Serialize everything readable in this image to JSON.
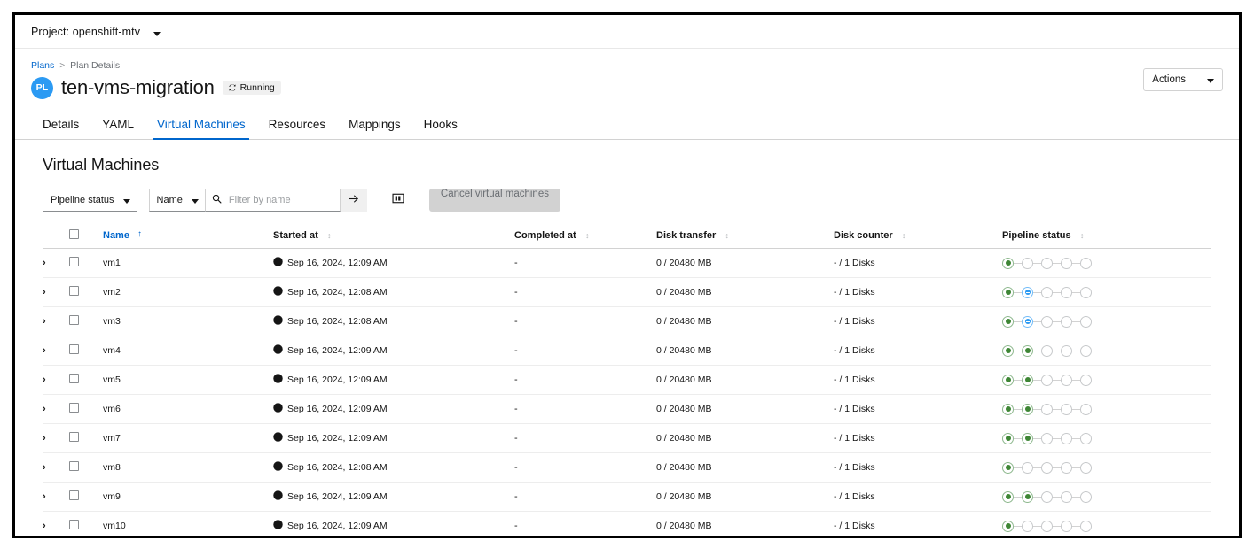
{
  "project_bar": {
    "label": "Project: openshift-mtv",
    "caret_icon": "chevron-down-icon"
  },
  "breadcrumb": {
    "root": "Plans",
    "separator": ">",
    "current": "Plan Details"
  },
  "header": {
    "badge": "PL",
    "title": "ten-vms-migration",
    "status": "Running",
    "status_icon": "sync-icon",
    "actions_label": "Actions",
    "actions_caret_icon": "chevron-down-icon"
  },
  "tabs": [
    {
      "label": "Details",
      "active": false
    },
    {
      "label": "YAML",
      "active": false
    },
    {
      "label": "Virtual Machines",
      "active": true
    },
    {
      "label": "Resources",
      "active": false
    },
    {
      "label": "Mappings",
      "active": false
    },
    {
      "label": "Hooks",
      "active": false
    }
  ],
  "section": {
    "title": "Virtual Machines"
  },
  "toolbar": {
    "pipeline_status_filter": "Pipeline status",
    "attribute_filter": "Name",
    "search_placeholder": "Filter by name",
    "search_value": "",
    "search_icon": "search-icon",
    "submit_icon": "arrow-right-icon",
    "columns_icon": "columns-management-icon",
    "cancel_label": "Cancel virtual machines"
  },
  "table": {
    "columns": [
      {
        "label": "",
        "sort": "none",
        "key": "toggle"
      },
      {
        "label": "",
        "sort": "none",
        "key": "checkbox"
      },
      {
        "label": "Name",
        "sort": "asc",
        "key": "name"
      },
      {
        "label": "Started at",
        "sort": "idle",
        "key": "started_at"
      },
      {
        "label": "Completed at",
        "sort": "idle",
        "key": "completed_at"
      },
      {
        "label": "Disk transfer",
        "sort": "idle",
        "key": "disk_transfer"
      },
      {
        "label": "Disk counter",
        "sort": "idle",
        "key": "disk_counter"
      },
      {
        "label": "Pipeline status",
        "sort": "idle",
        "key": "pipeline_status"
      }
    ],
    "sort_asc_glyph": "↑",
    "sort_idle_glyph": "↕",
    "expand_glyph": "›",
    "clock_icon": "globe-clock-icon",
    "rows": [
      {
        "name": "vm1",
        "started_at": "Sep 16, 2024, 12:09 AM",
        "completed_at": "-",
        "disk_transfer": "0 / 20480 MB",
        "disk_counter": "- / 1 Disks",
        "pipeline": [
          "green",
          "empty",
          "empty",
          "empty",
          "empty"
        ]
      },
      {
        "name": "vm2",
        "started_at": "Sep 16, 2024, 12:08 AM",
        "completed_at": "-",
        "disk_transfer": "0 / 20480 MB",
        "disk_counter": "- / 1 Disks",
        "pipeline": [
          "green",
          "blue",
          "empty",
          "empty",
          "empty"
        ]
      },
      {
        "name": "vm3",
        "started_at": "Sep 16, 2024, 12:08 AM",
        "completed_at": "-",
        "disk_transfer": "0 / 20480 MB",
        "disk_counter": "- / 1 Disks",
        "pipeline": [
          "green",
          "blue",
          "empty",
          "empty",
          "empty"
        ]
      },
      {
        "name": "vm4",
        "started_at": "Sep 16, 2024, 12:09 AM",
        "completed_at": "-",
        "disk_transfer": "0 / 20480 MB",
        "disk_counter": "- / 1 Disks",
        "pipeline": [
          "green",
          "green",
          "empty",
          "empty",
          "empty"
        ]
      },
      {
        "name": "vm5",
        "started_at": "Sep 16, 2024, 12:09 AM",
        "completed_at": "-",
        "disk_transfer": "0 / 20480 MB",
        "disk_counter": "- / 1 Disks",
        "pipeline": [
          "green",
          "green",
          "empty",
          "empty",
          "empty"
        ]
      },
      {
        "name": "vm6",
        "started_at": "Sep 16, 2024, 12:09 AM",
        "completed_at": "-",
        "disk_transfer": "0 / 20480 MB",
        "disk_counter": "- / 1 Disks",
        "pipeline": [
          "green",
          "green",
          "empty",
          "empty",
          "empty"
        ]
      },
      {
        "name": "vm7",
        "started_at": "Sep 16, 2024, 12:09 AM",
        "completed_at": "-",
        "disk_transfer": "0 / 20480 MB",
        "disk_counter": "- / 1 Disks",
        "pipeline": [
          "green",
          "green",
          "empty",
          "empty",
          "empty"
        ]
      },
      {
        "name": "vm8",
        "started_at": "Sep 16, 2024, 12:08 AM",
        "completed_at": "-",
        "disk_transfer": "0 / 20480 MB",
        "disk_counter": "- / 1 Disks",
        "pipeline": [
          "green",
          "empty",
          "empty",
          "empty",
          "empty"
        ]
      },
      {
        "name": "vm9",
        "started_at": "Sep 16, 2024, 12:09 AM",
        "completed_at": "-",
        "disk_transfer": "0 / 20480 MB",
        "disk_counter": "- / 1 Disks",
        "pipeline": [
          "green",
          "green",
          "empty",
          "empty",
          "empty"
        ]
      },
      {
        "name": "vm10",
        "started_at": "Sep 16, 2024, 12:09 AM",
        "completed_at": "-",
        "disk_transfer": "0 / 20480 MB",
        "disk_counter": "- / 1 Disks",
        "pipeline": [
          "green",
          "empty",
          "empty",
          "empty",
          "empty"
        ]
      }
    ]
  },
  "colors": {
    "link": "#0066cc",
    "accent": "#06c",
    "badge_bg": "#2b9af3",
    "status_green": "#3e8635",
    "status_blue": "#2b9af3",
    "border": "#d2d2d2"
  }
}
